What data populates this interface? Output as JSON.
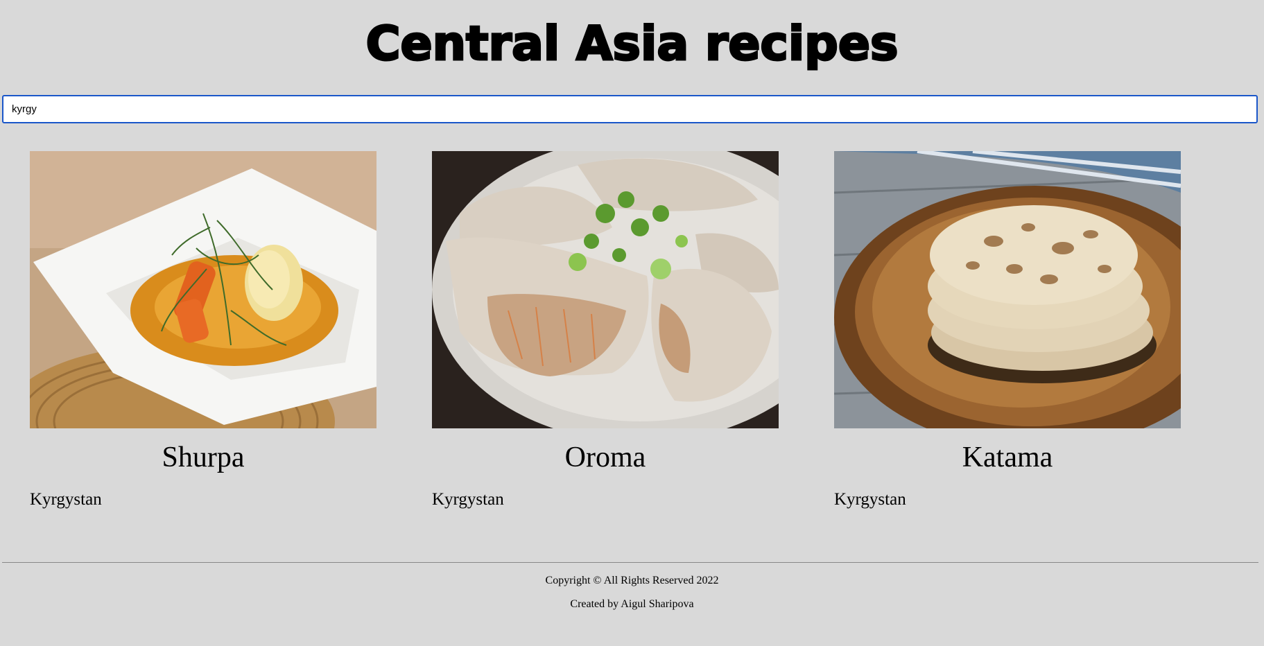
{
  "header": {
    "title": "Central Asia recipes"
  },
  "search": {
    "value": "kyrgy",
    "placeholder": ""
  },
  "recipes": [
    {
      "name": "Shurpa",
      "country": "Kyrgystan",
      "image": "soup-bowl-photo"
    },
    {
      "name": "Oroma",
      "country": "Kyrgystan",
      "image": "steamed-rolls-photo"
    },
    {
      "name": "Katama",
      "country": "Kyrgystan",
      "image": "flatbread-stack-photo"
    }
  ],
  "footer": {
    "copyright": "Copyright © All Rights Reserved 2022",
    "credit": "Created by Aigul Sharipova"
  }
}
